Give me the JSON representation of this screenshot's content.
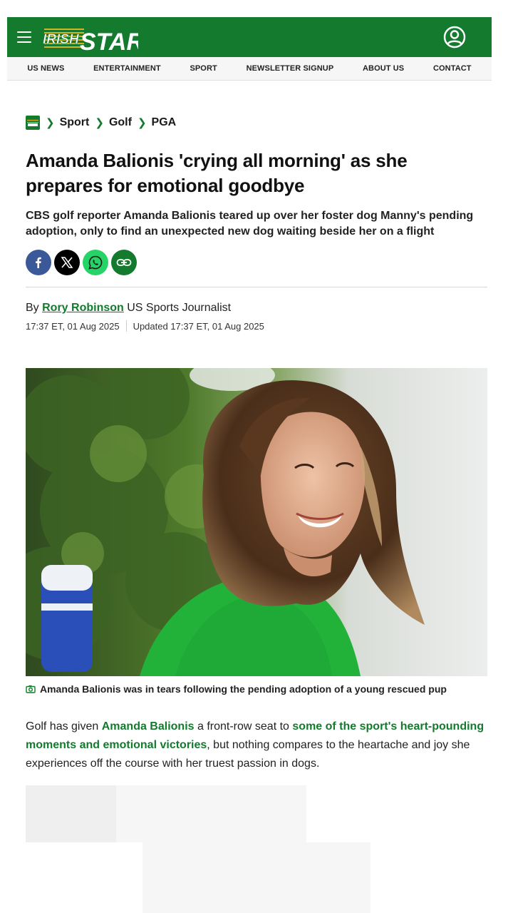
{
  "header": {
    "brand_left": "IRISH",
    "brand_right": "STAR",
    "icons": {
      "menu": "hamburger-menu-icon",
      "account": "user-account-icon"
    },
    "brand_color": "#137a2e"
  },
  "nav": {
    "items": [
      "US NEWS",
      "ENTERTAINMENT",
      "SPORT",
      "NEWSLETTER SIGNUP",
      "ABOUT US",
      "CONTACT"
    ]
  },
  "breadcrumb": {
    "items": [
      "Sport",
      "Golf",
      "PGA"
    ]
  },
  "article": {
    "headline": "Amanda Balionis 'crying all morning' as she prepares for emotional goodbye",
    "standfirst": "CBS golf reporter Amanda Balionis teared up over her foster dog Manny's pending adoption, only to find an unexpected new dog waiting beside her on a flight",
    "share_icons": [
      "facebook-icon",
      "x-icon",
      "whatsapp-icon",
      "copy-link-icon"
    ],
    "byline_prefix": "By",
    "author": "Rory Robinson",
    "author_role": "US Sports Journalist",
    "published": "17:37 ET, 01 Aug 2025",
    "updated": "Updated 17:37 ET, 01 Aug 2025",
    "image_caption": "Amanda Balionis was in tears following the pending adoption of a young rescued pup",
    "body": {
      "p1_before": "Golf has given ",
      "p1_link1": "Amanda Balionis",
      "p1_middle": " a front-row seat to ",
      "p1_link2": "some of the sport's heart-pounding moments and emotional victories",
      "p1_after": ", but nothing compares to the heartache and joy she experiences off the course with her truest passion in dogs."
    }
  }
}
